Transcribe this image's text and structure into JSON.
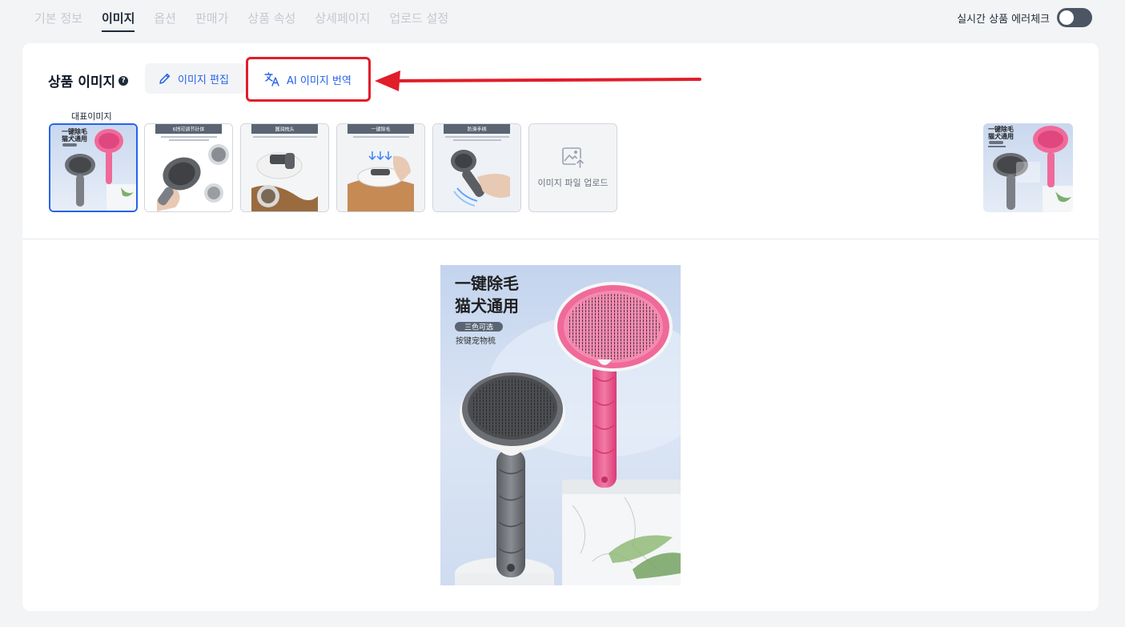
{
  "tabs": [
    {
      "label": "기본 정보",
      "active": false
    },
    {
      "label": "이미지",
      "active": true
    },
    {
      "label": "옵션",
      "active": false
    },
    {
      "label": "판매가",
      "active": false
    },
    {
      "label": "상품 속성",
      "active": false
    },
    {
      "label": "상세페이지",
      "active": false
    },
    {
      "label": "업로드 설정",
      "active": false
    }
  ],
  "error_check": {
    "label": "실시간 상품 에러체크",
    "enabled": false
  },
  "section": {
    "title": "상품 이미지",
    "help_icon": "help-icon",
    "edit_button": "이미지 편집",
    "translate_button": "AI 이미지 번역",
    "rep_label": "대표이미지",
    "upload_label": "이미지 파일 업로드"
  },
  "thumbnails": [
    {
      "caption_line1": "一键除毛",
      "caption_line2": "猫犬通用",
      "selected": true
    },
    {
      "caption": "6挡可调节针体",
      "selected": false
    },
    {
      "caption": "圆润梳头",
      "selected": false
    },
    {
      "caption": "一键除毛",
      "selected": false
    },
    {
      "caption": "防滑手柄",
      "selected": false
    }
  ],
  "preview": {
    "headline1": "一键除毛",
    "headline2": "猫犬通用",
    "badge": "三色可选",
    "subtitle": "按键宠物梳"
  },
  "colors": {
    "accent": "#2563eb",
    "highlight_box": "#e11d2a",
    "toggle_off": "#4b5563",
    "brush_pink": "#ef6a99",
    "brush_gray": "#6b6e73"
  },
  "icons": [
    "pencil-icon",
    "translate-icon",
    "arrow-annotation",
    "image-upload-icon",
    "help-icon"
  ]
}
